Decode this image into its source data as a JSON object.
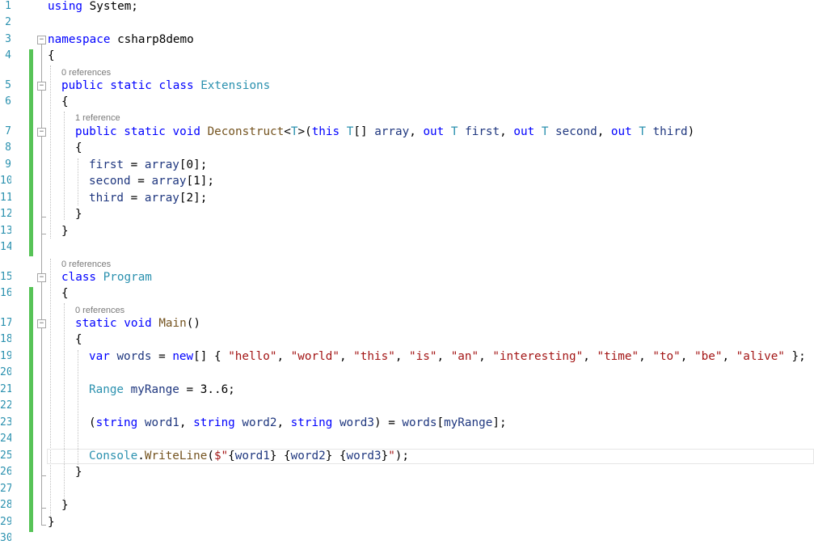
{
  "editor": {
    "line_numbers": [
      "1",
      "2",
      "3",
      "4",
      "5",
      "6",
      "7",
      "8",
      "9",
      "10",
      "11",
      "12",
      "13",
      "14",
      "15",
      "16",
      "17",
      "18",
      "19",
      "20",
      "21",
      "22",
      "23",
      "24",
      "25",
      "26",
      "27",
      "28",
      "29",
      "30"
    ],
    "code_lens": {
      "extensions_refs": "0 references",
      "deconstruct_refs": "1 reference",
      "program_refs": "0 references",
      "main_refs": "0 references"
    },
    "lines": {
      "l1": [
        "using",
        " System;"
      ],
      "l3": [
        "namespace",
        " csharp8demo"
      ],
      "l4": [
        "{"
      ],
      "l5": [
        "public",
        " ",
        "static",
        " ",
        "class",
        " ",
        "Extensions"
      ],
      "l6": [
        "{"
      ],
      "l7": [
        "public",
        " ",
        "static",
        " ",
        "void",
        " ",
        "Deconstruct",
        "<",
        "T",
        ">(",
        "this",
        " ",
        "T",
        "[] ",
        "array",
        ", ",
        "out",
        " ",
        "T",
        " ",
        "first",
        ", ",
        "out",
        " ",
        "T",
        " ",
        "second",
        ", ",
        "out",
        " ",
        "T",
        " ",
        "third",
        ")"
      ],
      "l8": [
        "{"
      ],
      "l9": [
        "first",
        " = ",
        "array",
        "[0];"
      ],
      "l10": [
        "second",
        " = ",
        "array",
        "[1];"
      ],
      "l11": [
        "third",
        " = ",
        "array",
        "[2];"
      ],
      "l12": [
        "}"
      ],
      "l13": [
        "}"
      ],
      "l15": [
        "class",
        " ",
        "Program"
      ],
      "l16": [
        "{"
      ],
      "l17": [
        "static",
        " ",
        "void",
        " ",
        "Main",
        "()"
      ],
      "l18": [
        "{"
      ],
      "l19": [
        "var",
        " ",
        "words",
        " = ",
        "new",
        "[] { ",
        "\"hello\"",
        ", ",
        "\"world\"",
        ", ",
        "\"this\"",
        ", ",
        "\"is\"",
        ", ",
        "\"an\"",
        ", ",
        "\"interesting\"",
        ", ",
        "\"time\"",
        ", ",
        "\"to\"",
        ", ",
        "\"be\"",
        ", ",
        "\"alive\"",
        " };"
      ],
      "l21": [
        "Range",
        " ",
        "myRange",
        " = 3..6;"
      ],
      "l23": [
        "(",
        "string",
        " ",
        "word1",
        ", ",
        "string",
        " ",
        "word2",
        ", ",
        "string",
        " ",
        "word3",
        ") = ",
        "words",
        "[",
        "myRange",
        "];"
      ],
      "l25": [
        "Console",
        ".",
        "WriteLine",
        "(",
        "$\"",
        "{",
        "word1",
        "} {",
        "word2",
        "} {",
        "word3",
        "}",
        "\"",
        ");"
      ],
      "l26": [
        "}"
      ],
      "l28": [
        "}"
      ],
      "l29": [
        "}"
      ]
    },
    "colors": {
      "keyword": "#0000ff",
      "type": "#2b91af",
      "string": "#a31515",
      "identifier": "#1f377f",
      "method": "#74531f",
      "line_number": "#2b91af",
      "change_bar": "#57c357"
    }
  }
}
